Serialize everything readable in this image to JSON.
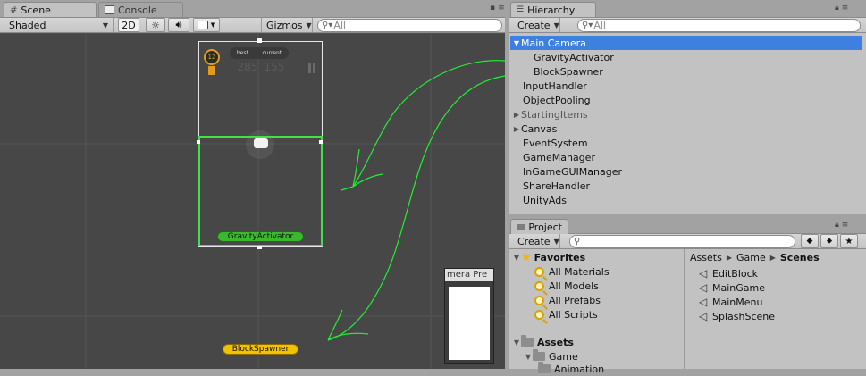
{
  "scene_panel": {
    "tabs": [
      {
        "label": "Scene",
        "icon": "grid-icon"
      },
      {
        "label": "Console",
        "icon": "console-icon"
      }
    ],
    "toolbar": {
      "shading_mode": "Shaded",
      "mode_2d": "2D",
      "gizmos": "Gizmos",
      "search_placeholder": "All"
    },
    "game_ui": {
      "best_label": "best",
      "current_label": "current",
      "best_score": "285",
      "current_score": "155",
      "level_badge": "12"
    },
    "objects": {
      "gravity_label": "GravityActivator",
      "spawner_label": "BlockSpawner"
    },
    "camera_preview_title": "Camera Preview",
    "camera_preview_visible": "mera Pre"
  },
  "hierarchy": {
    "title": "Hierarchy",
    "create_label": "Create",
    "search_placeholder": "All",
    "items": [
      {
        "label": "Main Camera",
        "expanded": true,
        "selected": true,
        "indent": 0
      },
      {
        "label": "GravityActivator",
        "indent": 1
      },
      {
        "label": "BlockSpawner",
        "indent": 1
      },
      {
        "label": "InputHandler",
        "indent": 0
      },
      {
        "label": "ObjectPooling",
        "indent": 0
      },
      {
        "label": "StartingItems",
        "collapsed": true,
        "dim": true,
        "indent": 0
      },
      {
        "label": "Canvas",
        "collapsed": true,
        "indent": 0
      },
      {
        "label": "EventSystem",
        "indent": 0
      },
      {
        "label": "GameManager",
        "indent": 0
      },
      {
        "label": "InGameGUIManager",
        "indent": 0
      },
      {
        "label": "ShareHandler",
        "indent": 0
      },
      {
        "label": "UnityAds",
        "indent": 0
      }
    ]
  },
  "project": {
    "title": "Project",
    "create_label": "Create",
    "favorites_label": "Favorites",
    "favorites": [
      "All Materials",
      "All Models",
      "All Prefabs",
      "All Scripts"
    ],
    "assets_label": "Assets",
    "assets_children": [
      "Game",
      "Animation"
    ],
    "breadcrumb": [
      "Assets",
      "Game",
      "Scenes"
    ],
    "scenes": [
      "EditBlock",
      "MainGame",
      "MainMenu",
      "SplashScene"
    ]
  },
  "colors": {
    "selection": "#3d80df",
    "annotation_arrow": "#22ee33",
    "scene_bg": "#474747",
    "gravity_button": "#39b92c",
    "spawner_button": "#f0c200"
  }
}
